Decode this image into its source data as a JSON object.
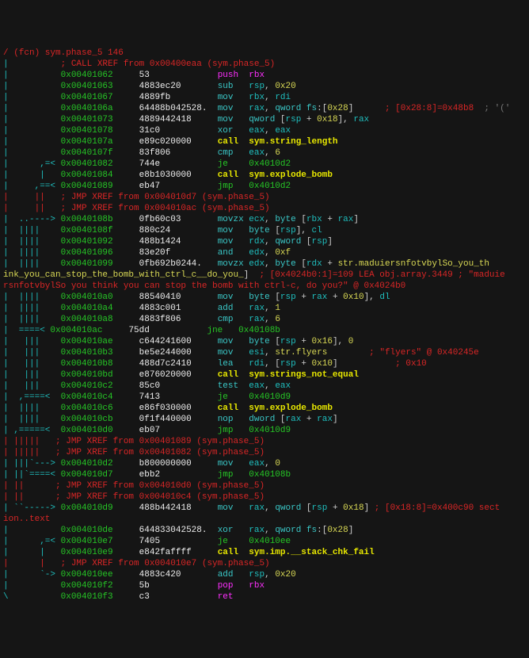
{
  "fn_header": "(fcn) sym.phase_5 146",
  "xref_top": "          ; CALL XREF from 0x00400eaa (sym.phase_5)",
  "rows": [
    {
      "flow": "|          ",
      "addr": "0x00401062",
      "bytes": "53",
      "mn": "push",
      "ops": [
        [
          "rbx",
          "magenta"
        ]
      ]
    },
    {
      "flow": "|          ",
      "addr": "0x00401063",
      "bytes": "4883ec20",
      "mn": "sub",
      "ops": [
        [
          "rsp",
          "cyan"
        ],
        [
          ", ",
          ""
        ],
        [
          "0x20",
          "yellow"
        ]
      ]
    },
    {
      "flow": "|          ",
      "addr": "0x00401067",
      "bytes": "4889fb",
      "mn": "mov",
      "ops": [
        [
          "rbx",
          "cyan"
        ],
        [
          ", ",
          ""
        ],
        [
          "rdi",
          "cyan"
        ]
      ]
    },
    {
      "flow": "|          ",
      "addr": "0x0040106a",
      "bytes": "64488b042528.",
      "mn": "mov",
      "ops": [
        [
          "rax",
          "cyan"
        ],
        [
          ", ",
          ""
        ],
        [
          "qword fs",
          "teal"
        ],
        [
          ":[",
          ""
        ],
        [
          "0x28",
          "yellow"
        ],
        [
          "]",
          ""
        ]
      ],
      "tail": "      ; [0x28:8]=0x48b8",
      "tail2": "  ; '('"
    },
    {
      "flow": "|          ",
      "addr": "0x00401073",
      "bytes": "4889442418",
      "mn": "mov",
      "ops": [
        [
          "qword ",
          "teal"
        ],
        [
          "[",
          ""
        ],
        [
          "rsp",
          "cyan"
        ],
        [
          " + ",
          ""
        ],
        [
          "0x18",
          "yellow"
        ],
        [
          "], ",
          ""
        ],
        [
          "rax",
          "cyan"
        ]
      ]
    },
    {
      "flow": "|          ",
      "addr": "0x00401078",
      "bytes": "31c0",
      "mn": "xor",
      "ops": [
        [
          "eax",
          "cyan"
        ],
        [
          ", ",
          ""
        ],
        [
          "eax",
          "cyan"
        ]
      ]
    },
    {
      "flow": "|          ",
      "addr": "0x0040107a",
      "bytes": "e89c020000",
      "mn": "call",
      "ops": [
        [
          "sym.string_length",
          "yel-bold"
        ]
      ]
    },
    {
      "flow": "|          ",
      "addr": "0x0040107f",
      "bytes": "83f806",
      "mn": "cmp",
      "ops": [
        [
          "eax",
          "cyan"
        ],
        [
          ", ",
          ""
        ],
        [
          "6",
          "yellow"
        ]
      ]
    },
    {
      "flow": "|      ,=< ",
      "addr": "0x00401082",
      "bytes": "744e",
      "mn": "je",
      "ops": [
        [
          "0x4010d2",
          "green"
        ]
      ]
    },
    {
      "flow": "|      |   ",
      "addr": "0x00401084",
      "bytes": "e8b1030000",
      "mn": "call",
      "ops": [
        [
          "sym.explode_bomb",
          "yel-bold"
        ]
      ]
    },
    {
      "flow": "|     ,==< ",
      "addr": "0x00401089",
      "bytes": "eb47",
      "mn": "jmp",
      "ops": [
        [
          "0x4010d2",
          "green"
        ]
      ]
    }
  ],
  "xref2a": "|     ||   ; JMP XREF from 0x004010d7 (sym.phase_5)",
  "xref2b": "|     ||   ; JMP XREF from 0x004010ac (sym.phase_5)",
  "rows2": [
    {
      "flow": "|  ..----> ",
      "addr": "0x0040108b",
      "bytes": "0fb60c03",
      "mn": "movzx",
      "ops": [
        [
          "ecx",
          "cyan"
        ],
        [
          ", ",
          ""
        ],
        [
          "byte ",
          "teal"
        ],
        [
          "[",
          ""
        ],
        [
          "rbx",
          "cyan"
        ],
        [
          " + ",
          ""
        ],
        [
          "rax",
          "cyan"
        ],
        [
          "]",
          ""
        ]
      ]
    },
    {
      "flow": "|  ||||    ",
      "addr": "0x0040108f",
      "bytes": "880c24",
      "mn": "mov",
      "ops": [
        [
          "byte ",
          "teal"
        ],
        [
          "[",
          ""
        ],
        [
          "rsp",
          "cyan"
        ],
        [
          "], ",
          ""
        ],
        [
          "cl",
          "cyan"
        ]
      ]
    },
    {
      "flow": "|  ||||    ",
      "addr": "0x00401092",
      "bytes": "488b1424",
      "mn": "mov",
      "ops": [
        [
          "rdx",
          "cyan"
        ],
        [
          ", ",
          ""
        ],
        [
          "qword ",
          "teal"
        ],
        [
          "[",
          ""
        ],
        [
          "rsp",
          "cyan"
        ],
        [
          "]",
          ""
        ]
      ]
    },
    {
      "flow": "|  ||||    ",
      "addr": "0x00401096",
      "bytes": "83e20f",
      "mn": "and",
      "ops": [
        [
          "edx",
          "cyan"
        ],
        [
          ", ",
          ""
        ],
        [
          "0xf",
          "yellow"
        ]
      ]
    }
  ],
  "row_str": {
    "flow": "|  ||||    ",
    "addr": "0x00401099",
    "bytes": "0fb692b0244.",
    "mn": "movzx",
    "ops": [
      [
        "edx",
        "cyan"
      ],
      [
        ", ",
        ""
      ],
      [
        "byte ",
        "teal"
      ],
      [
        "[",
        ""
      ],
      [
        "rdx",
        "cyan"
      ],
      [
        " + ",
        ""
      ],
      [
        "str.maduiersnfotvbylSo_you_th",
        "yellow"
      ]
    ]
  },
  "str_wrap1": "ink_you_can_stop_the_bomb_with_ctrl_c__do_you_",
  "str_tail": "]",
  "str_cmnt1": "  ; [0x4024b0:1]=109 LEA obj.array.3449 ; \"maduie",
  "str_wrap2": "rsnfotvbylSo you think you can stop the bomb with ctrl-c, do you?\" @ 0x4024b0",
  "rows3": [
    {
      "flow": "|  ||||    ",
      "addr": "0x004010a0",
      "bytes": "88540410",
      "mn": "mov",
      "ops": [
        [
          "byte ",
          "teal"
        ],
        [
          "[",
          ""
        ],
        [
          "rsp",
          "cyan"
        ],
        [
          " + ",
          ""
        ],
        [
          "rax",
          "cyan"
        ],
        [
          " + ",
          ""
        ],
        [
          "0x10",
          "yellow"
        ],
        [
          "], ",
          ""
        ],
        [
          "dl",
          "cyan"
        ]
      ]
    },
    {
      "flow": "|  ||||    ",
      "addr": "0x004010a4",
      "bytes": "4883c001",
      "mn": "add",
      "ops": [
        [
          "rax",
          "cyan"
        ],
        [
          ", ",
          ""
        ],
        [
          "1",
          "yellow"
        ]
      ]
    },
    {
      "flow": "|  ||||    ",
      "addr": "0x004010a8",
      "bytes": "4883f806",
      "mn": "cmp",
      "ops": [
        [
          "rax",
          "cyan"
        ],
        [
          ", ",
          ""
        ],
        [
          "6",
          "yellow"
        ]
      ]
    },
    {
      "flow": "|  ====< ",
      "addr": "0x004010ac",
      "bytes": "75dd",
      "mn": "jne",
      "ops": [
        [
          "0x40108b",
          "green"
        ]
      ]
    },
    {
      "flow": "|   |||    ",
      "addr": "0x004010ae",
      "bytes": "c644241600",
      "mn": "mov",
      "ops": [
        [
          "byte ",
          "teal"
        ],
        [
          "[",
          ""
        ],
        [
          "rsp",
          "cyan"
        ],
        [
          " + ",
          ""
        ],
        [
          "0x16",
          "yellow"
        ],
        [
          "], ",
          ""
        ],
        [
          "0",
          "yellow"
        ]
      ]
    },
    {
      "flow": "|   |||    ",
      "addr": "0x004010b3",
      "bytes": "be5e244000",
      "mn": "mov",
      "ops": [
        [
          "esi",
          "cyan"
        ],
        [
          ", ",
          ""
        ],
        [
          "str.flyers",
          "yellow"
        ]
      ],
      "tail": "        ; \"flyers\" @ 0x40245e"
    },
    {
      "flow": "|   |||    ",
      "addr": "0x004010b8",
      "bytes": "488d7c2410",
      "mn": "lea",
      "ops": [
        [
          "rdi",
          "cyan"
        ],
        [
          ", [",
          ""
        ],
        [
          "rsp",
          "cyan"
        ],
        [
          " + ",
          ""
        ],
        [
          "0x10",
          "yellow"
        ],
        [
          "]",
          ""
        ]
      ],
      "tail": "           ; 0x10"
    },
    {
      "flow": "|   |||    ",
      "addr": "0x004010bd",
      "bytes": "e876020000",
      "mn": "call",
      "ops": [
        [
          "sym.strings_not_equal",
          "yel-bold"
        ]
      ]
    },
    {
      "flow": "|   |||    ",
      "addr": "0x004010c2",
      "bytes": "85c0",
      "mn": "test",
      "ops": [
        [
          "eax",
          "cyan"
        ],
        [
          ", ",
          ""
        ],
        [
          "eax",
          "cyan"
        ]
      ]
    },
    {
      "flow": "|  ,====<  ",
      "addr": "0x004010c4",
      "bytes": "7413",
      "mn": "je",
      "ops": [
        [
          "0x4010d9",
          "green"
        ]
      ]
    },
    {
      "flow": "|  ||||    ",
      "addr": "0x004010c6",
      "bytes": "e86f030000",
      "mn": "call",
      "ops": [
        [
          "sym.explode_bomb",
          "yel-bold"
        ]
      ]
    },
    {
      "flow": "|  ||||    ",
      "addr": "0x004010cb",
      "bytes": "0f1f440000",
      "mn": "nop",
      "ops": [
        [
          "dword ",
          "teal"
        ],
        [
          "[",
          ""
        ],
        [
          "rax",
          "cyan"
        ],
        [
          " + ",
          ""
        ],
        [
          "rax",
          "cyan"
        ],
        [
          "]",
          ""
        ]
      ]
    },
    {
      "flow": "| ,=====<  ",
      "addr": "0x004010d0",
      "bytes": "eb07",
      "mn": "jmp",
      "ops": [
        [
          "0x4010d9",
          "green"
        ]
      ]
    }
  ],
  "xref3a": "| |||||   ; JMP XREF from 0x00401089 (sym.phase_5)",
  "xref3b": "| |||||   ; JMP XREF from 0x00401082 (sym.phase_5)",
  "rows4": [
    {
      "flow": "| |||`---> ",
      "addr": "0x004010d2",
      "bytes": "b800000000",
      "mn": "mov",
      "ops": [
        [
          "eax",
          "cyan"
        ],
        [
          ", ",
          ""
        ],
        [
          "0",
          "yellow"
        ]
      ]
    },
    {
      "flow": "| ||`====< ",
      "addr": "0x004010d7",
      "bytes": "ebb2",
      "mn": "jmp",
      "ops": [
        [
          "0x40108b",
          "green"
        ]
      ]
    }
  ],
  "xref4a": "| ||      ; JMP XREF from 0x004010d0 (sym.phase_5)",
  "xref4b": "| ||      ; JMP XREF from 0x004010c4 (sym.phase_5)",
  "row_sec": {
    "flow": "| ``-----> ",
    "addr": "0x004010d9",
    "bytes": "488b442418",
    "mn": "mov",
    "ops": [
      [
        "rax",
        "cyan"
      ],
      [
        ", ",
        ""
      ],
      [
        "qword ",
        "teal"
      ],
      [
        "[",
        ""
      ],
      [
        "rsp",
        "cyan"
      ],
      [
        " + ",
        ""
      ],
      [
        "0x18",
        "yellow"
      ],
      [
        "]",
        ""
      ]
    ],
    "tail": " ; [0x18:8]=0x400c90 sect"
  },
  "sec_wrap": "ion..text",
  "rows5": [
    {
      "flow": "|          ",
      "addr": "0x004010de",
      "bytes": "644833042528.",
      "mn": "xor",
      "ops": [
        [
          "rax",
          "cyan"
        ],
        [
          ", ",
          ""
        ],
        [
          "qword fs",
          "teal"
        ],
        [
          ":[",
          ""
        ],
        [
          "0x28",
          "yellow"
        ],
        [
          "]",
          ""
        ]
      ]
    },
    {
      "flow": "|      ,=< ",
      "addr": "0x004010e7",
      "bytes": "7405",
      "mn": "je",
      "ops": [
        [
          "0x4010ee",
          "green"
        ]
      ]
    },
    {
      "flow": "|      |   ",
      "addr": "0x004010e9",
      "bytes": "e842faffff",
      "mn": "call",
      "ops": [
        [
          "sym.imp.__stack_chk_fail",
          "yel-bold"
        ]
      ]
    }
  ],
  "xref5": "|      |   ; JMP XREF from 0x004010e7 (sym.phase_5)",
  "rows6": [
    {
      "flow": "|      `-> ",
      "addr": "0x004010ee",
      "bytes": "4883c420",
      "mn": "add",
      "ops": [
        [
          "rsp",
          "cyan"
        ],
        [
          ", ",
          ""
        ],
        [
          "0x20",
          "yellow"
        ]
      ]
    },
    {
      "flow": "|          ",
      "addr": "0x004010f2",
      "bytes": "5b",
      "mn": "pop",
      "ops": [
        [
          "rbx",
          "magenta"
        ]
      ]
    },
    {
      "flow": "\\          ",
      "addr": "0x004010f3",
      "bytes": "c3",
      "mn": "ret",
      "ops": []
    }
  ]
}
